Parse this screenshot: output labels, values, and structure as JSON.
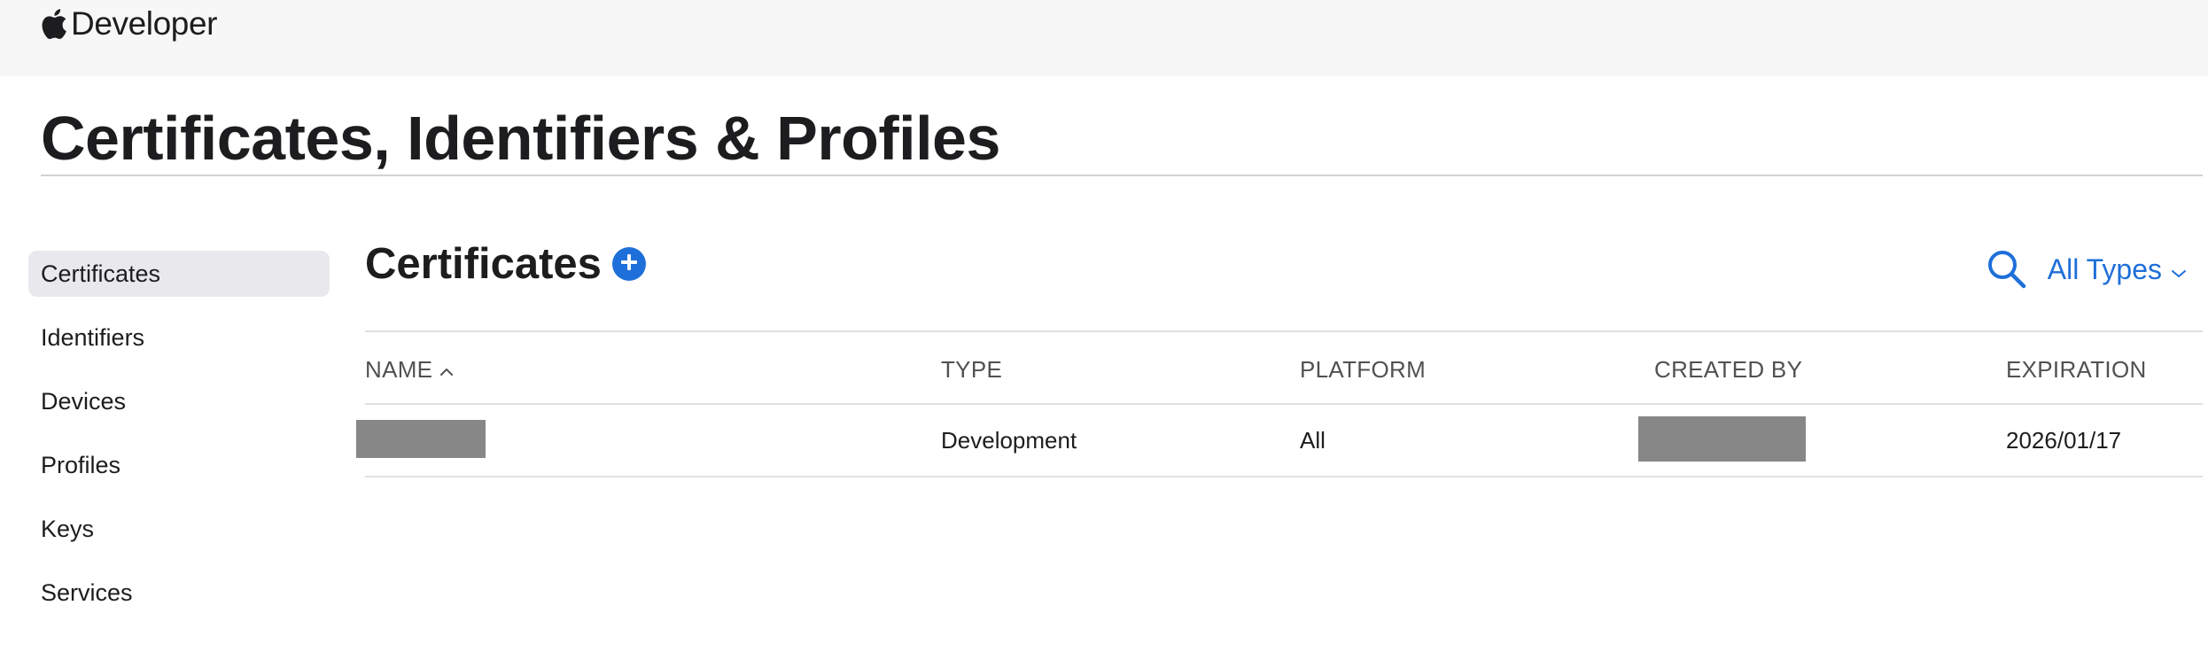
{
  "header": {
    "brand": "Developer"
  },
  "page": {
    "title": "Certificates, Identifiers & Profiles"
  },
  "sidebar": {
    "items": [
      {
        "label": "Certificates",
        "active": true
      },
      {
        "label": "Identifiers"
      },
      {
        "label": "Devices"
      },
      {
        "label": "Profiles"
      },
      {
        "label": "Keys"
      },
      {
        "label": "Services"
      }
    ]
  },
  "main": {
    "section_title": "Certificates",
    "filter_label": "All Types",
    "columns": {
      "name": "NAME",
      "type": "TYPE",
      "platform": "PLATFORM",
      "created_by": "CREATED BY",
      "expiration": "EXPIRATION"
    },
    "rows": [
      {
        "name": "",
        "type": "Development",
        "platform": "All",
        "created_by": "",
        "expiration": "2026/01/17"
      }
    ]
  },
  "colors": {
    "accent": "#1e6fd9",
    "redaction": "#878787",
    "active_item_bg": "#e8e8ed"
  },
  "icons": {
    "brand": "apple-logo-icon",
    "add": "plus-circle-icon",
    "search": "search-icon",
    "filter": "chevron-down-icon",
    "sort": "chevron-up-icon"
  }
}
